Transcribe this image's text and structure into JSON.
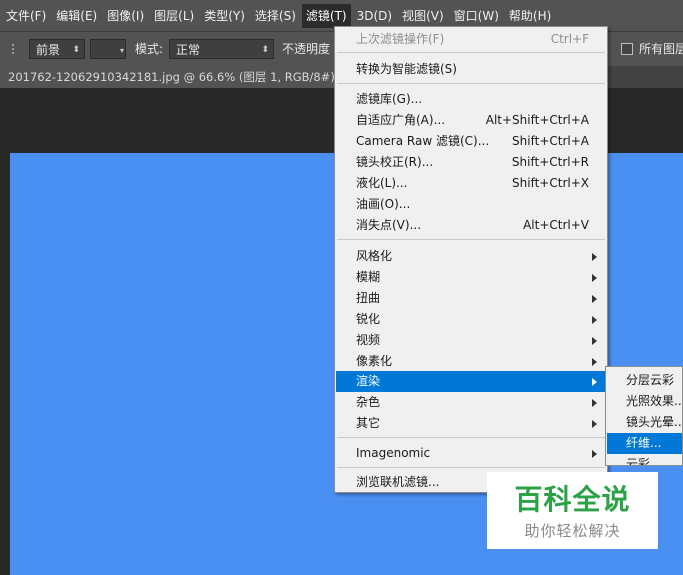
{
  "menubar": {
    "items": [
      "文件(F)",
      "编辑(E)",
      "图像(I)",
      "图层(L)",
      "类型(Y)",
      "选择(S)",
      "滤镜(T)",
      "3D(D)",
      "视图(V)",
      "窗口(W)",
      "帮助(H)"
    ]
  },
  "options": {
    "source_value": "前景",
    "mode_label": "模式:",
    "mode_value": "正常",
    "opacity_label": "不透明度",
    "all_layers_label": "所有图层"
  },
  "document": {
    "tab_title": "201762-12062910342181.jpg @ 66.6% (图层 1, RGB/8#) *"
  },
  "filter_menu": {
    "last_filter": {
      "label": "上次滤镜操作(F)",
      "shortcut": "Ctrl+F"
    },
    "convert_smart": {
      "label": "转换为智能滤镜(S)"
    },
    "gallery": {
      "label": "滤镜库(G)..."
    },
    "adaptive_wide": {
      "label": "自适应广角(A)...",
      "shortcut": "Alt+Shift+Ctrl+A"
    },
    "camera_raw": {
      "label": "Camera Raw 滤镜(C)...",
      "shortcut": "Shift+Ctrl+A"
    },
    "lens_correction": {
      "label": "镜头校正(R)...",
      "shortcut": "Shift+Ctrl+R"
    },
    "liquify": {
      "label": "液化(L)...",
      "shortcut": "Shift+Ctrl+X"
    },
    "oil_paint": {
      "label": "油画(O)..."
    },
    "vanishing_point": {
      "label": "消失点(V)...",
      "shortcut": "Alt+Ctrl+V"
    },
    "stylize": {
      "label": "风格化"
    },
    "blur": {
      "label": "模糊"
    },
    "distort": {
      "label": "扭曲"
    },
    "sharpen": {
      "label": "锐化"
    },
    "video": {
      "label": "视频"
    },
    "pixelate": {
      "label": "像素化"
    },
    "render": {
      "label": "渲染"
    },
    "noise": {
      "label": "杂色"
    },
    "other": {
      "label": "其它"
    },
    "imagenomic": {
      "label": "Imagenomic"
    },
    "browse_online": {
      "label": "浏览联机滤镜..."
    }
  },
  "render_submenu": {
    "items": [
      "分层云彩",
      "光照效果...",
      "镜头光晕...",
      "纤维...",
      "云彩"
    ]
  },
  "watermark": {
    "main": "百科全说",
    "sub": "助你轻松解决"
  },
  "colors": {
    "canvas": "#4a90f3",
    "highlight": "#0078d7",
    "menubar": "#535353",
    "watermark_green": "#2ba245"
  }
}
